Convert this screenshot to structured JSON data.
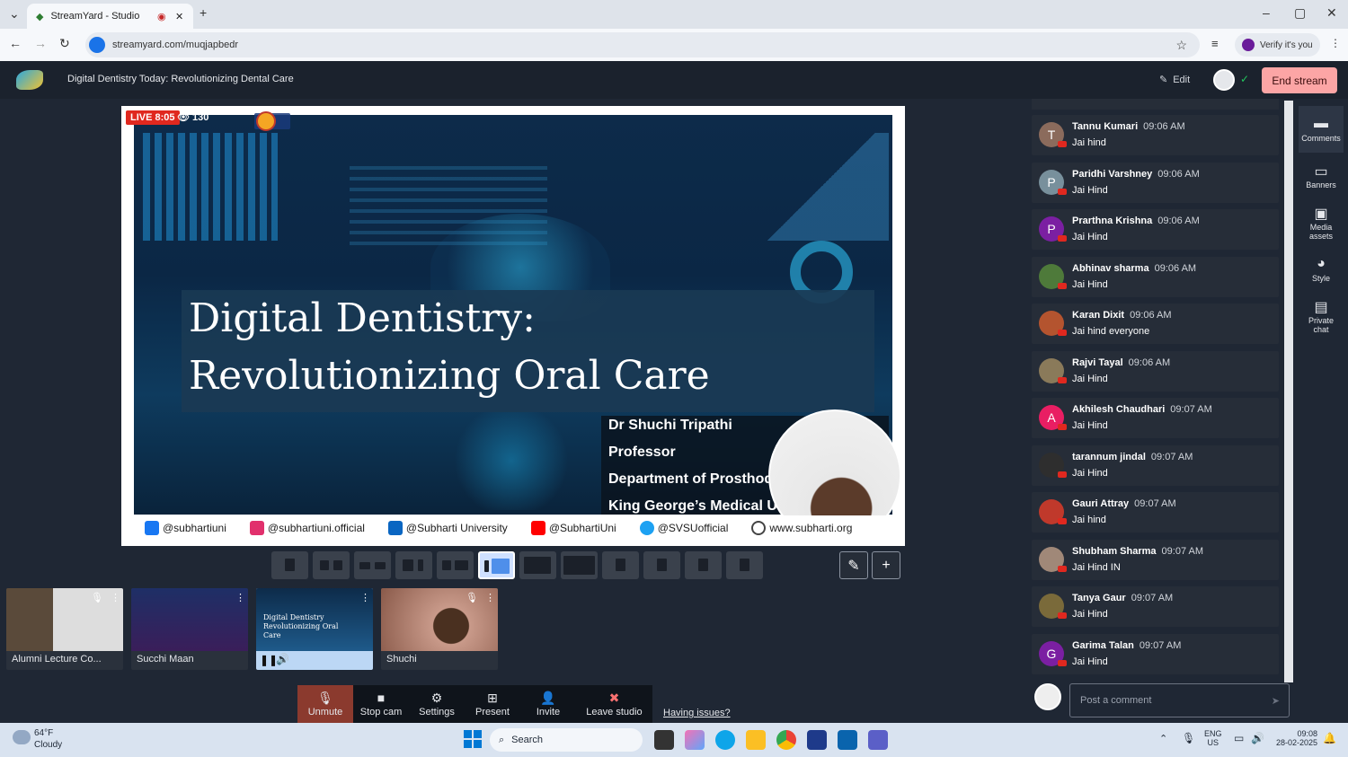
{
  "browser": {
    "tab_title": "StreamYard - Studio",
    "new_tab": "+",
    "url": "streamyard.com/muqjapbedr",
    "profile_label": "Verify it's you"
  },
  "studio": {
    "title": "Digital Dentistry Today: Revolutionizing Dental Care",
    "edit_label": "Edit",
    "end_stream_label": "End stream"
  },
  "stage": {
    "live_badge": "LIVE 8:05",
    "viewer_count": "130",
    "slide_title_line1": "Digital Dentistry:",
    "slide_title_line2": "Revolutionizing Oral Care",
    "lower_third": [
      "Dr Shuchi Tripathi",
      "Professor",
      "Department of Prosthodo",
      "King George’s Medical Ur"
    ],
    "social": [
      "@subhartiuni",
      "@subhartiuni.official",
      "@Subharti University",
      "@SubhartiUni",
      "@SVSUofficial",
      "www.subharti.org"
    ],
    "social_colors": [
      "#1877f2",
      "#e1306c",
      "#0a66c2",
      "#ff0000",
      "#1da1f2",
      "#444444"
    ]
  },
  "thumbnails": [
    {
      "label": "Alumni Lecture Co..."
    },
    {
      "label": "Succhi Maan"
    },
    {
      "label": "Digital Dentistry Revolutionizing Oral Care"
    },
    {
      "label": "Shuchi"
    }
  ],
  "controls": [
    {
      "icon": "mic-off-icon",
      "glyph": "🎙",
      "label": "Unmute"
    },
    {
      "icon": "camera-icon",
      "glyph": "■",
      "label": "Stop cam"
    },
    {
      "icon": "gear-icon",
      "glyph": "⚙",
      "label": "Settings"
    },
    {
      "icon": "present-icon",
      "glyph": "⊞",
      "label": "Present"
    },
    {
      "icon": "invite-icon",
      "glyph": "👤",
      "label": "Invite"
    },
    {
      "icon": "leave-icon",
      "glyph": "✖",
      "label": "Leave studio"
    }
  ],
  "having_issues": "Having issues?",
  "comments": [
    {
      "name": "Tannu Kumari",
      "time": "09:06 AM",
      "text": "Jai hind",
      "initial": "T",
      "color": "#8b6b5c"
    },
    {
      "name": "Paridhi Varshney",
      "time": "09:06 AM",
      "text": "Jai Hind",
      "initial": "P",
      "color": "#78909c"
    },
    {
      "name": "Prarthna Krishna",
      "time": "09:06 AM",
      "text": "Jai Hind",
      "initial": "P",
      "color": "#7b1fa2"
    },
    {
      "name": "Abhinav sharma",
      "time": "09:06 AM",
      "text": "Jai Hind",
      "initial": "",
      "color": "#4e7a3a"
    },
    {
      "name": "Karan Dixit",
      "time": "09:06 AM",
      "text": "Jai hind everyone",
      "initial": "",
      "color": "#b4542f"
    },
    {
      "name": "Rajvi Tayal",
      "time": "09:06 AM",
      "text": "Jai Hind",
      "initial": "",
      "color": "#8a7a5a"
    },
    {
      "name": "Akhilesh Chaudhari",
      "time": "09:07 AM",
      "text": "Jai Hind",
      "initial": "A",
      "color": "#e91e63"
    },
    {
      "name": "tarannum jindal",
      "time": "09:07 AM",
      "text": "Jai Hind",
      "initial": "",
      "color": "#2e2e2e"
    },
    {
      "name": "Gauri Attray",
      "time": "09:07 AM",
      "text": "Jai hind",
      "initial": "",
      "color": "#c0392b"
    },
    {
      "name": "Shubham Sharma",
      "time": "09:07 AM",
      "text": "Jai Hind IN",
      "initial": "",
      "color": "#a08878"
    },
    {
      "name": "Tanya Gaur",
      "time": "09:07 AM",
      "text": "Jai Hind",
      "initial": "",
      "color": "#7a6a3a"
    },
    {
      "name": "Garima Talan",
      "time": "09:07 AM",
      "text": "Jai Hind",
      "initial": "G",
      "color": "#7b1fa2"
    }
  ],
  "comment_placeholder": "Post a comment",
  "side_tabs": [
    {
      "label": "Comments",
      "glyph": "▬"
    },
    {
      "label": "Banners",
      "glyph": "▭"
    },
    {
      "label": "Media assets",
      "glyph": "▣"
    },
    {
      "label": "Style",
      "glyph": "◕"
    },
    {
      "label": "Private chat",
      "glyph": "▤"
    }
  ],
  "taskbar": {
    "weather_temp": "64°F",
    "weather_desc": "Cloudy",
    "search_placeholder": "Search",
    "lang": "ENG",
    "region": "US",
    "time": "09:08",
    "date": "28-02-2025"
  }
}
